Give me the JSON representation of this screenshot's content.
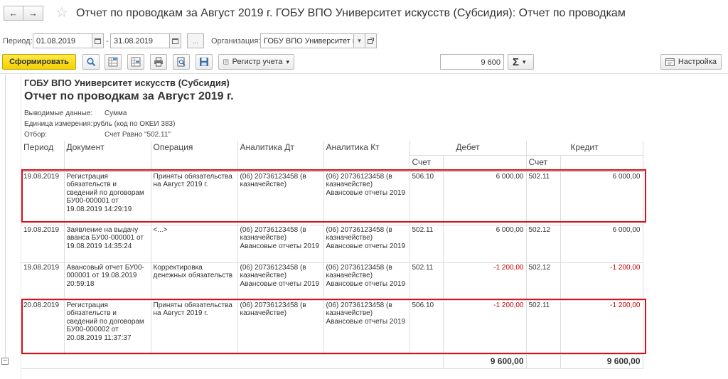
{
  "window": {
    "title": "Отчет по проводкам за Август 2019 г. ГОБУ ВПО Университет искусств (Субсидия): Отчет по проводкам",
    "back_icon": "←",
    "forward_icon": "→",
    "star_icon": "☆"
  },
  "filters": {
    "period_label": "Период:",
    "date_from": "01.08.2019",
    "date_to": "31.08.2019",
    "dots_label": "...",
    "org_label": "Организация:",
    "org_value": "ГОБУ ВПО Университет и"
  },
  "toolbar": {
    "generate_label": "Сформировать",
    "register_label": "Регистр учета",
    "sum_value": "9 600",
    "sigma_label": "Σ",
    "settings_label": "Настройка"
  },
  "report": {
    "org_name": "ГОБУ ВПО Университет искусств (Субсидия)",
    "title": "Отчет по проводкам за Август 2019 г.",
    "params": [
      {
        "label": "Выводимые данные:",
        "value": "Сумма"
      },
      {
        "label": "Единица измерения:",
        "value": "рубль (код по ОКЕИ 383)"
      },
      {
        "label": "Отбор:",
        "value": "Счет Равно \"502.11\""
      }
    ],
    "headers": {
      "period": "Период",
      "document": "Документ",
      "operation": "Операция",
      "analytics_dt": "Аналитика Дт",
      "analytics_kt": "Аналитика Кт",
      "debit": "Дебет",
      "credit": "Кредит",
      "account": "Счет"
    },
    "rows": [
      {
        "period": "19.08.2019",
        "document": "Регистрация обязательств и сведений по договорам БУ00-000001 от 19.08.2019 14:29:19",
        "operation": "Приняты обязательства на Август 2019 г.",
        "analytics_dt": "(06) 20736123458 (в казначействе)",
        "analytics_kt": "(06) 20736123458 (в казначействе) Авансовые отчеты 2019",
        "dt_account": "506.10",
        "dt_amount": "6 000,00",
        "kt_account": "502.11",
        "kt_amount": "6 000,00"
      },
      {
        "period": "19.08.2019",
        "document": "Заявление на выдачу аванса БУ00-000001 от 19.08.2019 14:35:24",
        "operation": "<...>",
        "analytics_dt": "(06) 20736123458 (в казначействе) Авансовые отчеты 2019",
        "analytics_kt": "(06) 20736123458 (в казначействе) Авансовые отчеты 2019",
        "dt_account": "502.11",
        "dt_amount": "6 000,00",
        "kt_account": "502.12",
        "kt_amount": "6 000,00"
      },
      {
        "period": "19.08.2019",
        "document": "Авансовый отчет БУ00-000001 от 19.08.2019 20:59:18",
        "operation": "Корректировка денежных обязательств",
        "analytics_dt": "(06) 20736123458 (в казначействе) Авансовые отчеты 2019",
        "analytics_kt": "(06) 20736123458 (в казначействе) Авансовые отчеты 2019",
        "dt_account": "502.11",
        "dt_amount": "-1 200,00",
        "kt_account": "502.12",
        "kt_amount": "-1 200,00"
      },
      {
        "period": "20.08.2019",
        "document": "Регистрация обязательств и сведений по договорам БУ00-000002 от 20.08.2019 11:37:37",
        "operation": "Приняты обязательства на Август 2019 г.",
        "analytics_dt": "(06) 20736123458 (в казначействе)",
        "analytics_kt": "(06) 20736123458 (в казначействе) Авансовые отчеты 2019",
        "dt_account": "506.10",
        "dt_amount": "-1 200,00",
        "kt_account": "502.11",
        "kt_amount": "-1 200,00"
      }
    ],
    "totals": {
      "debit": "9 600,00",
      "credit": "9 600,00"
    },
    "collapse_icon": "−"
  },
  "colors": {
    "accent_yellow": "#f5d100",
    "negative": "#c00000",
    "highlight": "#d9111a"
  }
}
